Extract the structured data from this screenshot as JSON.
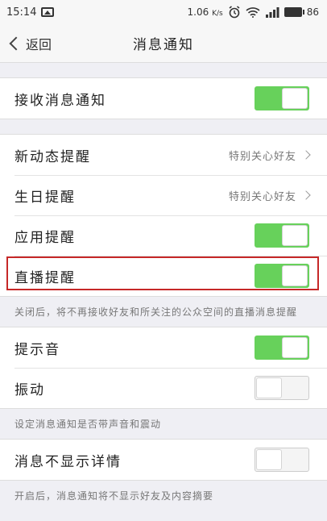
{
  "status_bar": {
    "time": "15:14",
    "network_speed": "1.06",
    "speed_unit": "K/s",
    "battery_level": "86"
  },
  "navbar": {
    "back_label": "返回",
    "title": "消息通知"
  },
  "receive": {
    "label": "接收消息通知",
    "enabled": true
  },
  "reminders": {
    "new_activity": {
      "label": "新动态提醒",
      "value": "特别关心好友"
    },
    "birthday": {
      "label": "生日提醒",
      "value": "特别关心好友"
    },
    "app": {
      "label": "应用提醒",
      "enabled": true
    },
    "live": {
      "label": "直播提醒",
      "enabled": true
    },
    "note": "关闭后，将不再接收好友和所关注的公众空间的直播消息提醒"
  },
  "sound": {
    "tone": {
      "label": "提示音",
      "enabled": true
    },
    "vibrate": {
      "label": "振动",
      "enabled": false
    },
    "note": "设定消息通知是否带声音和震动"
  },
  "details": {
    "hide_details": {
      "label": "消息不显示详情",
      "enabled": false
    },
    "note": "开启后，消息通知将不显示好友及内容摘要"
  },
  "colors": {
    "toggle_on": "#67d15b",
    "highlight_border": "#c62828"
  },
  "icons": [
    "image-icon",
    "alarm-icon",
    "wifi-icon",
    "signal-icon",
    "battery-icon",
    "back-chevron-icon",
    "chevron-right-icon"
  ]
}
